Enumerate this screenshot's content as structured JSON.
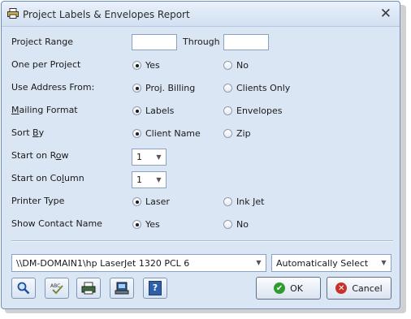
{
  "window": {
    "title": "Project Labels & Envelopes Report",
    "close_glyph": "✕"
  },
  "form": {
    "project_range": {
      "label": "Project Range",
      "from_value": "",
      "through_label": "Through",
      "through_value": ""
    },
    "one_per_project": {
      "label": "One per Project",
      "options": [
        "Yes",
        "No"
      ],
      "selected": "Yes"
    },
    "use_address_from": {
      "label": "Use Address From:",
      "options": [
        "Proj. Billing",
        "Clients Only"
      ],
      "selected": "Proj. Billing"
    },
    "mailing_format": {
      "label_prefix": "M",
      "label_rest": "ailing Format",
      "options": [
        "Labels",
        "Envelopes"
      ],
      "selected": "Labels"
    },
    "sort_by": {
      "label_prefix": "Sort ",
      "label_u": "B",
      "label_rest": "y",
      "options": [
        "Client Name",
        "Zip"
      ],
      "selected": "Client Name"
    },
    "start_on_row": {
      "label_prefix": "Start on R",
      "label_u": "o",
      "label_rest": "w",
      "value": "1"
    },
    "start_on_column": {
      "label_prefix": "Start on Co",
      "label_u": "l",
      "label_rest": "umn",
      "value": "1"
    },
    "printer_type": {
      "label": "Printer Type",
      "options": [
        "Laser",
        "Ink Jet"
      ],
      "selected": "Laser"
    },
    "show_contact_name": {
      "label": "Show Contact Name",
      "options": [
        "Yes",
        "No"
      ],
      "selected": "Yes"
    }
  },
  "printer": {
    "value": "\\\\DM-DOMAIN1\\hp LaserJet 1320 PCL 6"
  },
  "tray": {
    "value": "Automatically Select"
  },
  "toolbar": {
    "icons": [
      "magnifier-icon",
      "spellcheck-icon",
      "print-preview-icon",
      "print-icon",
      "help-icon"
    ],
    "help_glyph": "?"
  },
  "buttons": {
    "ok": "OK",
    "cancel": "Cancel",
    "ok_glyph": "✔",
    "cancel_glyph": "✕"
  },
  "colors": {
    "dialog_bg": "#dbe6f4",
    "ok_icon": "#2f9a2f",
    "cancel_icon": "#c8312a"
  }
}
